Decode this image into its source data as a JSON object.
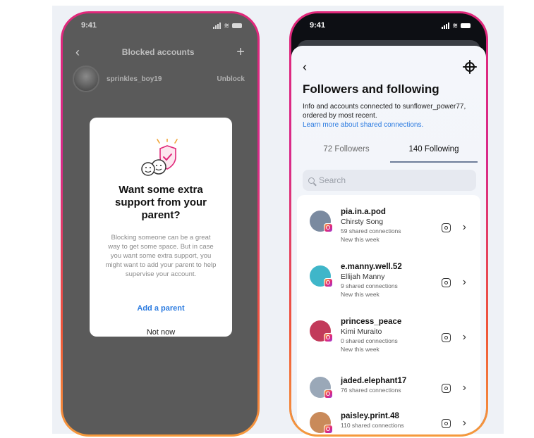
{
  "left_phone": {
    "status_time": "9:41",
    "nav_title": "Blocked accounts",
    "back_glyph": "‹",
    "plus_glyph": "+",
    "blocked_user": {
      "username": "sprinkles_boy19",
      "action": "Unblock"
    },
    "modal": {
      "title": "Want some extra support from your parent?",
      "body": "Blocking someone can be a great way to get some space. But in case you want some extra support, you might want to add your parent to help supervise your account.",
      "primary_label": "Add a parent",
      "secondary_label": "Not now",
      "illustration_icon": "faces-shield-icon"
    }
  },
  "right_phone": {
    "status_time": "9:41",
    "back_glyph": "‹",
    "settings_icon": "gear-icon",
    "title": "Followers and following",
    "description": "Info and accounts connected to sunflower_power77, ordered by most recent.",
    "learn_more": "Learn more about shared connections.",
    "tabs": [
      {
        "label": "72 Followers",
        "active": false
      },
      {
        "label": "140 Following",
        "active": true
      }
    ],
    "search": {
      "placeholder": "Search"
    },
    "accounts": [
      {
        "username": "pia.in.a.pod",
        "name": "Chirsty Song",
        "shared": "59 shared connections",
        "note": "New this week",
        "avatar_color": "#7a8aa0"
      },
      {
        "username": "e.manny.well.52",
        "name": "Ellijah Manny",
        "shared": "9 shared connections",
        "note": "New this week",
        "avatar_color": "#3fb6c9"
      },
      {
        "username": "princess_peace",
        "name": "Kimi Muraito",
        "shared": "0 shared connections",
        "note": "New this week",
        "avatar_color": "#c23a5a"
      },
      {
        "username": "jaded.elephant17",
        "name": "",
        "shared": "76 shared connections",
        "note": "",
        "avatar_color": "#9aa8b8"
      },
      {
        "username": "paisley.print.48",
        "name": "",
        "shared": "110 shared connections",
        "note": "",
        "avatar_color": "#c98a5a"
      }
    ],
    "chevron_glyph": "›"
  }
}
